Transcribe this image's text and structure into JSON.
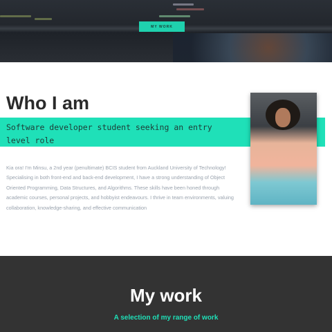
{
  "hero": {
    "button_label": "MY WORK"
  },
  "about": {
    "title": "Who I am",
    "tagline": "Software developer student seeking an entry level role",
    "bio": "Kia ora! I'm Minsu, a 2nd year (penultimate) BCIS student from Auckland University of Technology! Specialising in both front-end and back-end development, I have a strong understanding of Object Oriented Programming, Data Structures, and Algorithms. These skills have been honed through academic courses, personal projects, and hobbyist endeavours. I thrive in team environments, valuing collaboration, knowledge-sharing, and effective communication"
  },
  "work": {
    "title": "My work",
    "subtitle": "A selection of my range of work"
  },
  "colors": {
    "accent": "#1fe0b8",
    "dark": "#333333"
  }
}
